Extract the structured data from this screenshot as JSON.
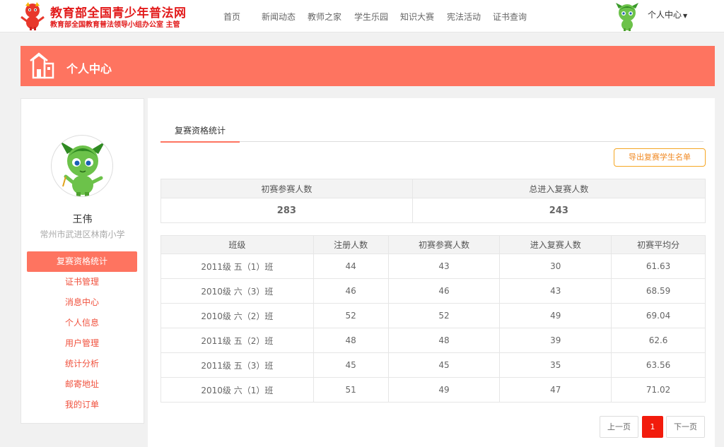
{
  "header": {
    "site_title": "教育部全国青少年普法网",
    "site_subtitle": "教育部全国教育普法领导小组办公室 主管",
    "nav": [
      "首页",
      "新闻动态",
      "教师之家",
      "学生乐园",
      "知识大赛",
      "宪法活动",
      "证书查询"
    ],
    "user_menu_label": "个人中心",
    "caret": "▼"
  },
  "banner": {
    "title": "个人中心"
  },
  "profile": {
    "name": "王伟",
    "school": "常州市武进区林南小学"
  },
  "sidebar": {
    "items": [
      {
        "label": "复赛资格统计",
        "active": true
      },
      {
        "label": "证书管理"
      },
      {
        "label": "消息中心"
      },
      {
        "label": "个人信息"
      },
      {
        "label": "用户管理"
      },
      {
        "label": "统计分析"
      },
      {
        "label": "邮寄地址"
      },
      {
        "label": "我的订单"
      }
    ]
  },
  "main": {
    "tab_label": "复赛资格统计",
    "export_label": "导出复赛学生名单",
    "summary": {
      "headers": [
        "初赛参赛人数",
        "总进入复赛人数"
      ],
      "values": [
        "283",
        "243"
      ]
    },
    "table": {
      "headers": [
        "班级",
        "注册人数",
        "初赛参赛人数",
        "进入复赛人数",
        "初赛平均分"
      ],
      "rows": [
        [
          "2011级 五（1）班",
          "44",
          "43",
          "30",
          "61.63"
        ],
        [
          "2010级 六（3）班",
          "46",
          "46",
          "43",
          "68.59"
        ],
        [
          "2010级 六（2）班",
          "52",
          "52",
          "49",
          "69.04"
        ],
        [
          "2011级 五（2）班",
          "48",
          "48",
          "39",
          "62.6"
        ],
        [
          "2011级 五（3）班",
          "45",
          "45",
          "35",
          "63.56"
        ],
        [
          "2010级 六（1）班",
          "51",
          "49",
          "47",
          "71.02"
        ]
      ]
    },
    "pagination": {
      "prev": "上一页",
      "current": "1",
      "next": "下一页"
    }
  },
  "colors": {
    "accent": "#fe7460",
    "brand_red": "#e21b1b",
    "export_border": "#f5a623",
    "page_active": "#f21b0c"
  },
  "icons": {
    "logo": "mascot-logo-icon",
    "avatar": "dragon-mascot-avatar",
    "banner": "house-icon"
  }
}
